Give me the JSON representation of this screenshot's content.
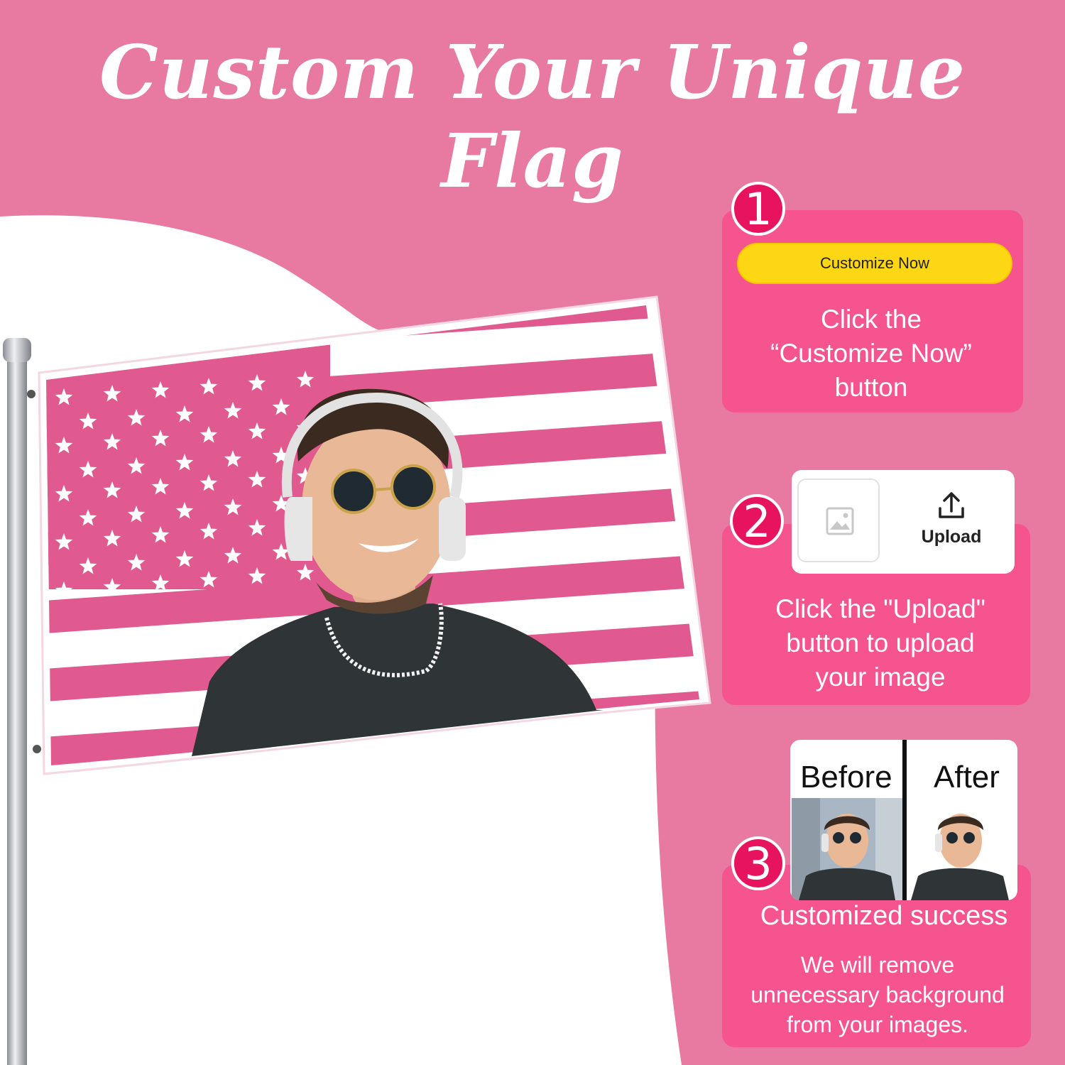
{
  "title": "Custom Your Unique Flag",
  "colors": {
    "background": "#e87aa2",
    "card": "#f5548e",
    "badge": "#e8135f",
    "button": "#fdd714",
    "flag_stripe": "#e05a8f"
  },
  "steps": [
    {
      "number": "1",
      "button_label": "Customize Now",
      "text_lines": [
        "Click the",
        "“Customize Now”",
        "button"
      ]
    },
    {
      "number": "2",
      "button_label": "Upload",
      "text_lines": [
        "Click the \"Upload\"",
        "button to upload",
        "your image"
      ]
    },
    {
      "number": "3",
      "before_label": "Before",
      "after_label": "After",
      "heading": "Customized success",
      "text_lines": [
        "We will remove",
        "unnecessary background",
        "from your images."
      ]
    }
  ],
  "icons": [
    "image-placeholder-icon",
    "upload-icon"
  ]
}
